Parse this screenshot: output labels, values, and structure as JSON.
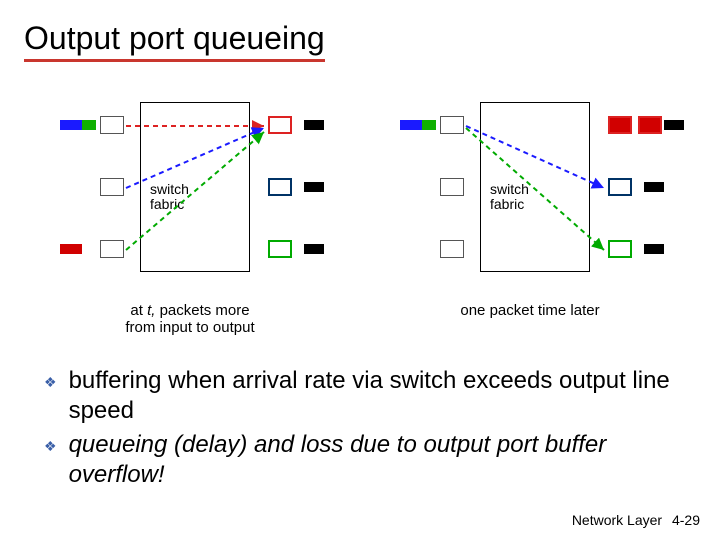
{
  "title": "Output port queueing",
  "diagrams": {
    "left": {
      "fabric_label": "switch\nfabric",
      "caption_prefix": "at ",
      "caption_t": "t,",
      "caption_rest": " packets more\nfrom input to output"
    },
    "right": {
      "fabric_label": "switch\nfabric",
      "caption": "one packet time later"
    }
  },
  "bullets": [
    "buffering when arrival rate via switch exceeds output line speed",
    "queueing (delay) and loss due to output port buffer overflow!"
  ],
  "footer": {
    "section": "Network Layer",
    "page": "4-29"
  }
}
